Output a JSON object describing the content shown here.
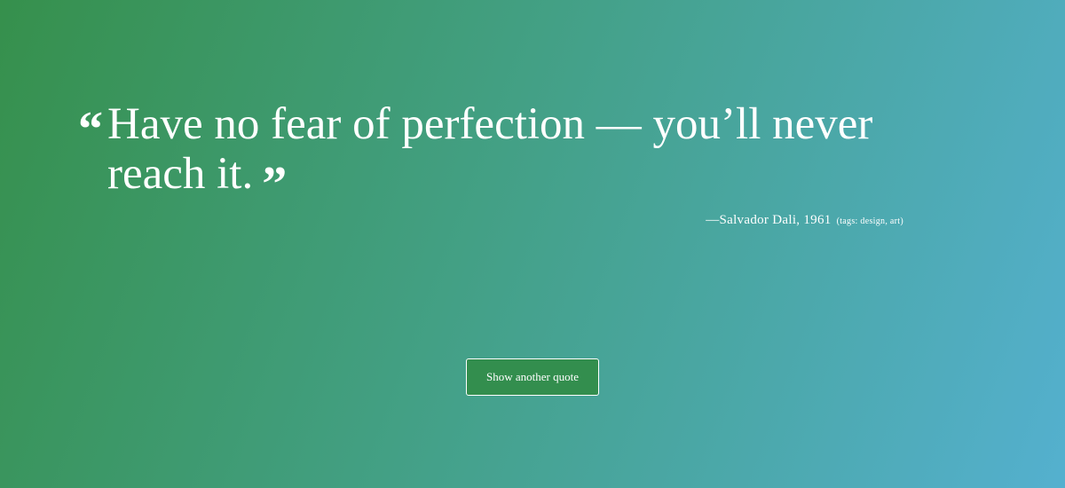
{
  "quote": {
    "open_mark": "“",
    "text": "Have no fear of perfection — you’ll never reach it.",
    "close_mark": "”",
    "author_line": "—Salvador Dali, 1961",
    "tags": "(tags: design, art)"
  },
  "button": {
    "label": "Show another quote"
  },
  "colors": {
    "gradient_start": "#36904c",
    "gradient_end": "#54b0cf",
    "button_bg": "#338e4e"
  }
}
